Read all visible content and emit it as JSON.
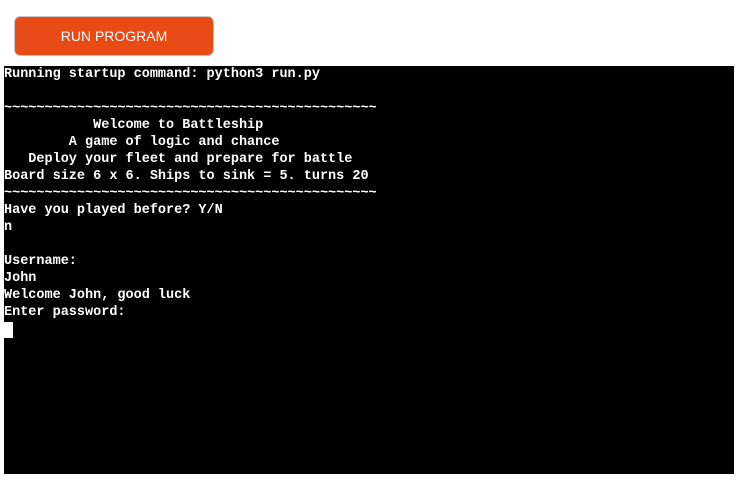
{
  "toolbar": {
    "run_label": "RUN PROGRAM"
  },
  "terminal": {
    "lines": [
      "Running startup command: python3 run.py",
      "",
      "~~~~~~~~~~~~~~~~~~~~~~~~~~~~~~~~~~~~~~~~~~~~~~",
      "           Welcome to Battleship",
      "        A game of logic and chance",
      "   Deploy your fleet and prepare for battle",
      "Board size 6 x 6. Ships to sink = 5. turns 20",
      "~~~~~~~~~~~~~~~~~~~~~~~~~~~~~~~~~~~~~~~~~~~~~~",
      "Have you played before? Y/N",
      "n",
      "",
      "Username:",
      "John",
      "Welcome John, good luck",
      "Enter password:"
    ]
  },
  "colors": {
    "button_bg": "#e84b15",
    "terminal_bg": "#000000",
    "terminal_fg": "#ffffff"
  }
}
